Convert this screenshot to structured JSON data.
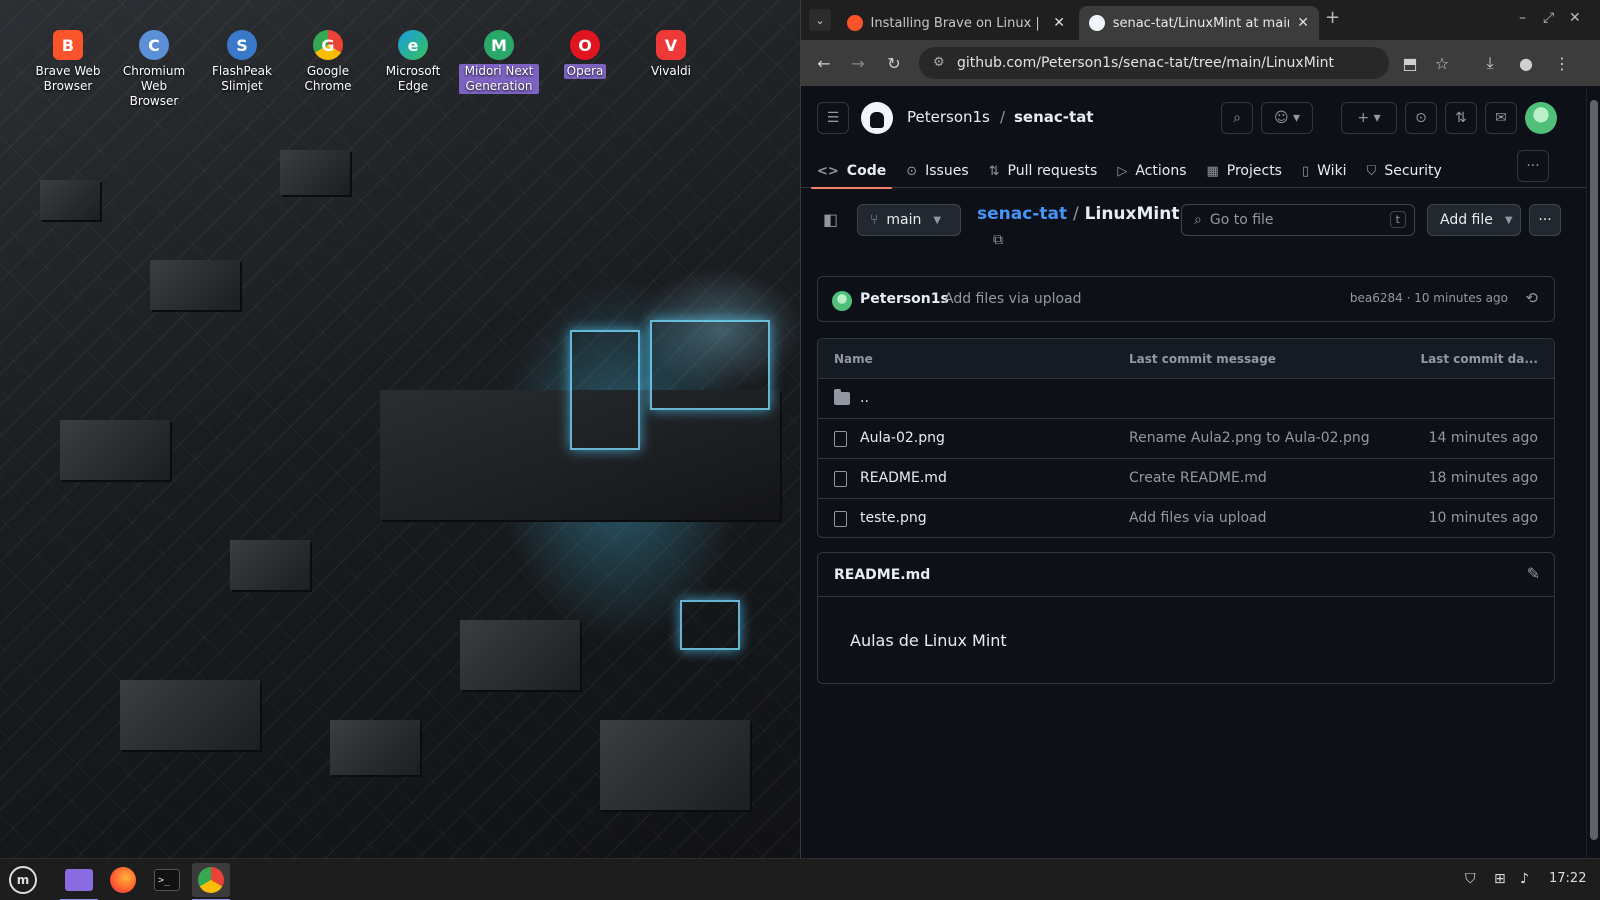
{
  "desktop": {
    "icons": [
      {
        "label": "Brave Web Browser",
        "color": "#fb542b",
        "glyph": "B"
      },
      {
        "label": "Chromium Web Browser",
        "color": "#5b8fd6",
        "glyph": "C"
      },
      {
        "label": "FlashPeak Slimjet",
        "color": "#3a78c9",
        "glyph": "S"
      },
      {
        "label": "Google Chrome",
        "color": "#34a853",
        "glyph": "G"
      },
      {
        "label": "Microsoft Edge",
        "color": "#1b9de2",
        "glyph": "e"
      },
      {
        "label": "Midori Next Generation",
        "color": "#2aa86a",
        "glyph": "M"
      },
      {
        "label": "Opera",
        "color": "#e0151f",
        "glyph": "O"
      },
      {
        "label": "Vivaldi",
        "color": "#ef3939",
        "glyph": "V"
      }
    ]
  },
  "browser": {
    "tabs": [
      {
        "title": "Installing Brave on Linux | Bra",
        "icon": "brave-icon",
        "color": "#fb542b"
      },
      {
        "title": "senac-tat/LinuxMint at main",
        "icon": "github-icon",
        "color": "#f0f6fc"
      }
    ],
    "url": "github.com/Peterson1s/senac-tat/tree/main/LinuxMint"
  },
  "github": {
    "owner": "Peterson1s",
    "separator": "/",
    "repo": "senac-tat",
    "nav": [
      {
        "label": "Code",
        "icon": "<>"
      },
      {
        "label": "Issues",
        "icon": "⊙"
      },
      {
        "label": "Pull requests",
        "icon": "⇅"
      },
      {
        "label": "Actions",
        "icon": "▷"
      },
      {
        "label": "Projects",
        "icon": "▦"
      },
      {
        "label": "Wiki",
        "icon": "▯"
      },
      {
        "label": "Security",
        "icon": "⛉"
      }
    ],
    "branch": "main",
    "path_repo": "senac-tat",
    "path_sep": "/",
    "path_dir": "LinuxMint",
    "path_trail": "/",
    "go_to_file_placeholder": "Go to file",
    "go_to_file_key": "t",
    "add_file": "Add file",
    "commit": {
      "author": "Peterson1s",
      "message": "Add files via upload",
      "info": "bea6284 · 10 minutes ago"
    },
    "table": {
      "headers": [
        "Name",
        "Last commit message",
        "Last commit da..."
      ],
      "parent": "..",
      "rows": [
        {
          "name": "Aula-02.png",
          "message": "Rename Aula2.png to Aula-02.png",
          "date": "14 minutes ago"
        },
        {
          "name": "README.md",
          "message": "Create README.md",
          "date": "18 minutes ago"
        },
        {
          "name": "teste.png",
          "message": "Add files via upload",
          "date": "10 minutes ago"
        }
      ]
    },
    "readme": {
      "title": "README.md",
      "body": "Aulas de Linux Mint"
    }
  },
  "taskbar": {
    "clock": "17:22",
    "apps": [
      "files",
      "firefox",
      "terminal",
      "chrome"
    ]
  }
}
